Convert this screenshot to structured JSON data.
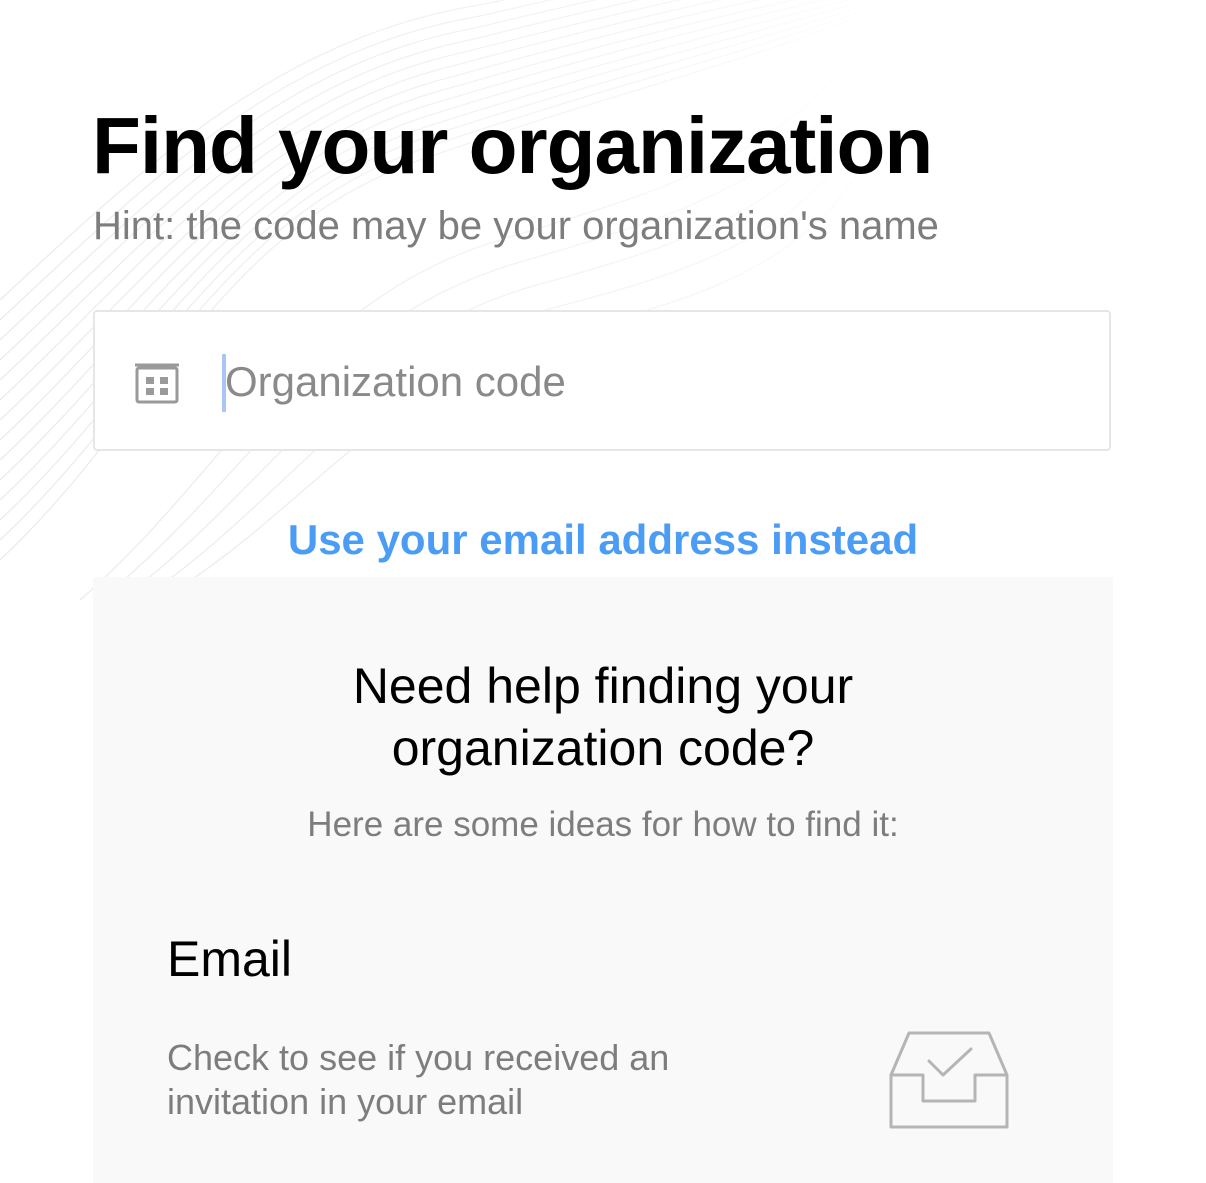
{
  "header": {
    "title": "Find your organization",
    "hint": "Hint: the code may be your organization's name"
  },
  "org_input": {
    "placeholder": "Organization code",
    "value": "",
    "icon": "building-icon"
  },
  "email_link": {
    "label": "Use your email address instead"
  },
  "help": {
    "title_line1": "Need help finding your",
    "title_line2": "organization code?",
    "subtitle": "Here are some ideas for how to find it:",
    "email_section": {
      "heading": "Email",
      "description_line1": "Check to see if you received an",
      "description_line2": "invitation in your email",
      "icon": "inbox-check-icon"
    }
  },
  "colors": {
    "link": "#4a9cf5",
    "hint_text": "#7d7d7d",
    "panel_bg": "#f9f9f9",
    "input_border": "#e6e6e6",
    "caret": "#a9c4f5"
  }
}
